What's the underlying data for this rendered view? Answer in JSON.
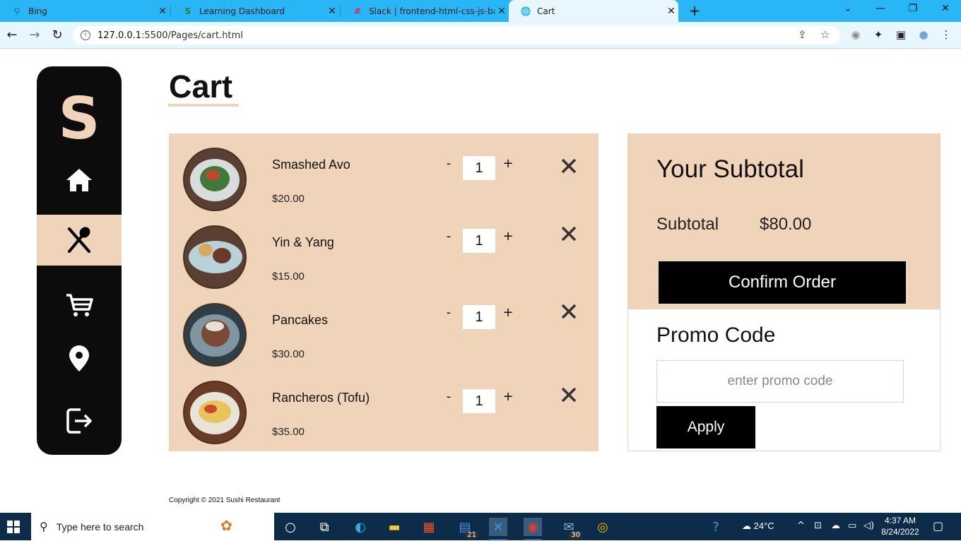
{
  "browser": {
    "tabs": [
      {
        "label": "Bing",
        "icon": "search-icon",
        "active": false
      },
      {
        "label": "Learning Dashboard",
        "icon": "s-logo-icon",
        "active": false
      },
      {
        "label": "Slack | frontend-html-css-js-batch",
        "icon": "slack-icon",
        "active": false
      },
      {
        "label": "Cart",
        "icon": "globe-icon",
        "active": true
      }
    ],
    "url_host": "127.0.0.1",
    "url_path": ":5500/Pages/cart.html"
  },
  "sidebar": {
    "logo": "S",
    "items": [
      {
        "name": "home",
        "icon": "home-icon",
        "active": false
      },
      {
        "name": "menu",
        "icon": "cutlery-icon",
        "active": true
      },
      {
        "name": "cart",
        "icon": "cart-icon",
        "active": false
      },
      {
        "name": "location",
        "icon": "location-pin-icon",
        "active": false
      },
      {
        "name": "logout",
        "icon": "logout-icon",
        "active": false
      }
    ]
  },
  "page": {
    "title": "Cart",
    "accent_color": "#efd4b9"
  },
  "cart": {
    "items": [
      {
        "name": "Smashed Avo",
        "price": "$20.00",
        "quantity": "1",
        "minus": "-",
        "plus": "+"
      },
      {
        "name": "Yin & Yang",
        "price": "$15.00",
        "quantity": "1",
        "minus": "-",
        "plus": "+"
      },
      {
        "name": "Pancakes",
        "price": "$30.00",
        "quantity": "1",
        "minus": "-",
        "plus": "+"
      },
      {
        "name": "Rancheros (Tofu)",
        "price": "$35.00",
        "quantity": "1",
        "minus": "-",
        "plus": "+"
      }
    ]
  },
  "summary": {
    "title": "Your Subtotal",
    "subtotal_label": "Subtotal",
    "subtotal_value": "$80.00",
    "confirm_label": "Confirm Order",
    "promo_title": "Promo Code",
    "promo_placeholder": "enter promo code",
    "apply_label": "Apply"
  },
  "footer": {
    "copyright": "Copyright © 2021 Sushi Restaurant"
  },
  "taskbar": {
    "search_placeholder": "Type here to search",
    "badges": {
      "teams": "21",
      "mail": "30"
    },
    "weather": "24°C",
    "time": "4:37 AM",
    "date": "8/24/2022"
  }
}
